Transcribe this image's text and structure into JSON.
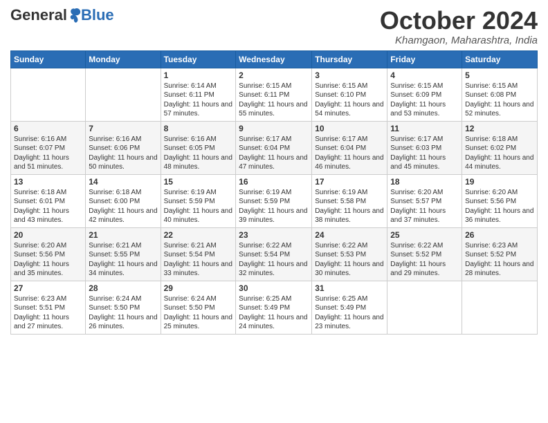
{
  "logo": {
    "general": "General",
    "blue": "Blue"
  },
  "header": {
    "month": "October 2024",
    "location": "Khamgaon, Maharashtra, India"
  },
  "days_of_week": [
    "Sunday",
    "Monday",
    "Tuesday",
    "Wednesday",
    "Thursday",
    "Friday",
    "Saturday"
  ],
  "weeks": [
    [
      {
        "day": "",
        "info": ""
      },
      {
        "day": "",
        "info": ""
      },
      {
        "day": "1",
        "info": "Sunrise: 6:14 AM\nSunset: 6:11 PM\nDaylight: 11 hours and 57 minutes."
      },
      {
        "day": "2",
        "info": "Sunrise: 6:15 AM\nSunset: 6:11 PM\nDaylight: 11 hours and 55 minutes."
      },
      {
        "day": "3",
        "info": "Sunrise: 6:15 AM\nSunset: 6:10 PM\nDaylight: 11 hours and 54 minutes."
      },
      {
        "day": "4",
        "info": "Sunrise: 6:15 AM\nSunset: 6:09 PM\nDaylight: 11 hours and 53 minutes."
      },
      {
        "day": "5",
        "info": "Sunrise: 6:15 AM\nSunset: 6:08 PM\nDaylight: 11 hours and 52 minutes."
      }
    ],
    [
      {
        "day": "6",
        "info": "Sunrise: 6:16 AM\nSunset: 6:07 PM\nDaylight: 11 hours and 51 minutes."
      },
      {
        "day": "7",
        "info": "Sunrise: 6:16 AM\nSunset: 6:06 PM\nDaylight: 11 hours and 50 minutes."
      },
      {
        "day": "8",
        "info": "Sunrise: 6:16 AM\nSunset: 6:05 PM\nDaylight: 11 hours and 48 minutes."
      },
      {
        "day": "9",
        "info": "Sunrise: 6:17 AM\nSunset: 6:04 PM\nDaylight: 11 hours and 47 minutes."
      },
      {
        "day": "10",
        "info": "Sunrise: 6:17 AM\nSunset: 6:04 PM\nDaylight: 11 hours and 46 minutes."
      },
      {
        "day": "11",
        "info": "Sunrise: 6:17 AM\nSunset: 6:03 PM\nDaylight: 11 hours and 45 minutes."
      },
      {
        "day": "12",
        "info": "Sunrise: 6:18 AM\nSunset: 6:02 PM\nDaylight: 11 hours and 44 minutes."
      }
    ],
    [
      {
        "day": "13",
        "info": "Sunrise: 6:18 AM\nSunset: 6:01 PM\nDaylight: 11 hours and 43 minutes."
      },
      {
        "day": "14",
        "info": "Sunrise: 6:18 AM\nSunset: 6:00 PM\nDaylight: 11 hours and 42 minutes."
      },
      {
        "day": "15",
        "info": "Sunrise: 6:19 AM\nSunset: 5:59 PM\nDaylight: 11 hours and 40 minutes."
      },
      {
        "day": "16",
        "info": "Sunrise: 6:19 AM\nSunset: 5:59 PM\nDaylight: 11 hours and 39 minutes."
      },
      {
        "day": "17",
        "info": "Sunrise: 6:19 AM\nSunset: 5:58 PM\nDaylight: 11 hours and 38 minutes."
      },
      {
        "day": "18",
        "info": "Sunrise: 6:20 AM\nSunset: 5:57 PM\nDaylight: 11 hours and 37 minutes."
      },
      {
        "day": "19",
        "info": "Sunrise: 6:20 AM\nSunset: 5:56 PM\nDaylight: 11 hours and 36 minutes."
      }
    ],
    [
      {
        "day": "20",
        "info": "Sunrise: 6:20 AM\nSunset: 5:56 PM\nDaylight: 11 hours and 35 minutes."
      },
      {
        "day": "21",
        "info": "Sunrise: 6:21 AM\nSunset: 5:55 PM\nDaylight: 11 hours and 34 minutes."
      },
      {
        "day": "22",
        "info": "Sunrise: 6:21 AM\nSunset: 5:54 PM\nDaylight: 11 hours and 33 minutes."
      },
      {
        "day": "23",
        "info": "Sunrise: 6:22 AM\nSunset: 5:54 PM\nDaylight: 11 hours and 32 minutes."
      },
      {
        "day": "24",
        "info": "Sunrise: 6:22 AM\nSunset: 5:53 PM\nDaylight: 11 hours and 30 minutes."
      },
      {
        "day": "25",
        "info": "Sunrise: 6:22 AM\nSunset: 5:52 PM\nDaylight: 11 hours and 29 minutes."
      },
      {
        "day": "26",
        "info": "Sunrise: 6:23 AM\nSunset: 5:52 PM\nDaylight: 11 hours and 28 minutes."
      }
    ],
    [
      {
        "day": "27",
        "info": "Sunrise: 6:23 AM\nSunset: 5:51 PM\nDaylight: 11 hours and 27 minutes."
      },
      {
        "day": "28",
        "info": "Sunrise: 6:24 AM\nSunset: 5:50 PM\nDaylight: 11 hours and 26 minutes."
      },
      {
        "day": "29",
        "info": "Sunrise: 6:24 AM\nSunset: 5:50 PM\nDaylight: 11 hours and 25 minutes."
      },
      {
        "day": "30",
        "info": "Sunrise: 6:25 AM\nSunset: 5:49 PM\nDaylight: 11 hours and 24 minutes."
      },
      {
        "day": "31",
        "info": "Sunrise: 6:25 AM\nSunset: 5:49 PM\nDaylight: 11 hours and 23 minutes."
      },
      {
        "day": "",
        "info": ""
      },
      {
        "day": "",
        "info": ""
      }
    ]
  ]
}
